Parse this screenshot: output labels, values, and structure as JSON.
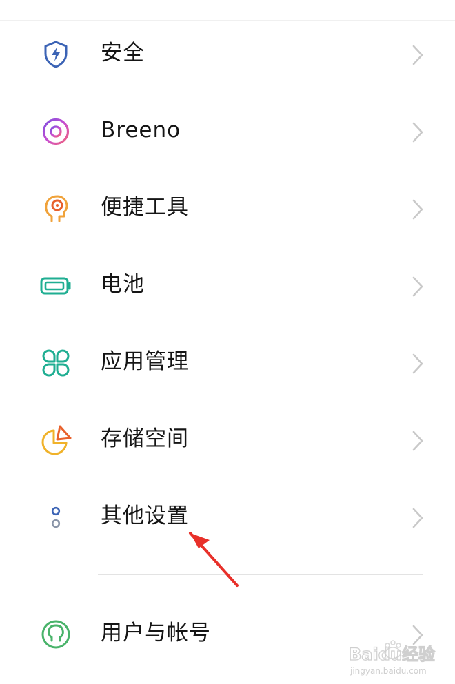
{
  "settings": {
    "items": [
      {
        "label": "安全",
        "icon": "shield-bolt-icon",
        "color": "#3b63b5"
      },
      {
        "label": "Breeno",
        "icon": "breeno-ring-icon",
        "color": "#b84fd3"
      },
      {
        "label": "便捷工具",
        "icon": "head-target-icon",
        "color": "#f0a23a"
      },
      {
        "label": "电池",
        "icon": "battery-icon",
        "color": "#1fae92"
      },
      {
        "label": "应用管理",
        "icon": "four-petal-icon",
        "color": "#1fae92"
      },
      {
        "label": "存储空间",
        "icon": "pie-chart-icon",
        "color": "#f0a23a"
      },
      {
        "label": "其他设置",
        "icon": "two-dots-icon",
        "color": "#6f7f9a"
      },
      {
        "label": "用户与帐号",
        "icon": "user-circle-icon",
        "color": "#49b36a"
      }
    ]
  },
  "annotation": {
    "color": "#e8302a"
  },
  "watermark": {
    "brand": "Baidu经验",
    "url": "jingyan.baidu.com"
  }
}
